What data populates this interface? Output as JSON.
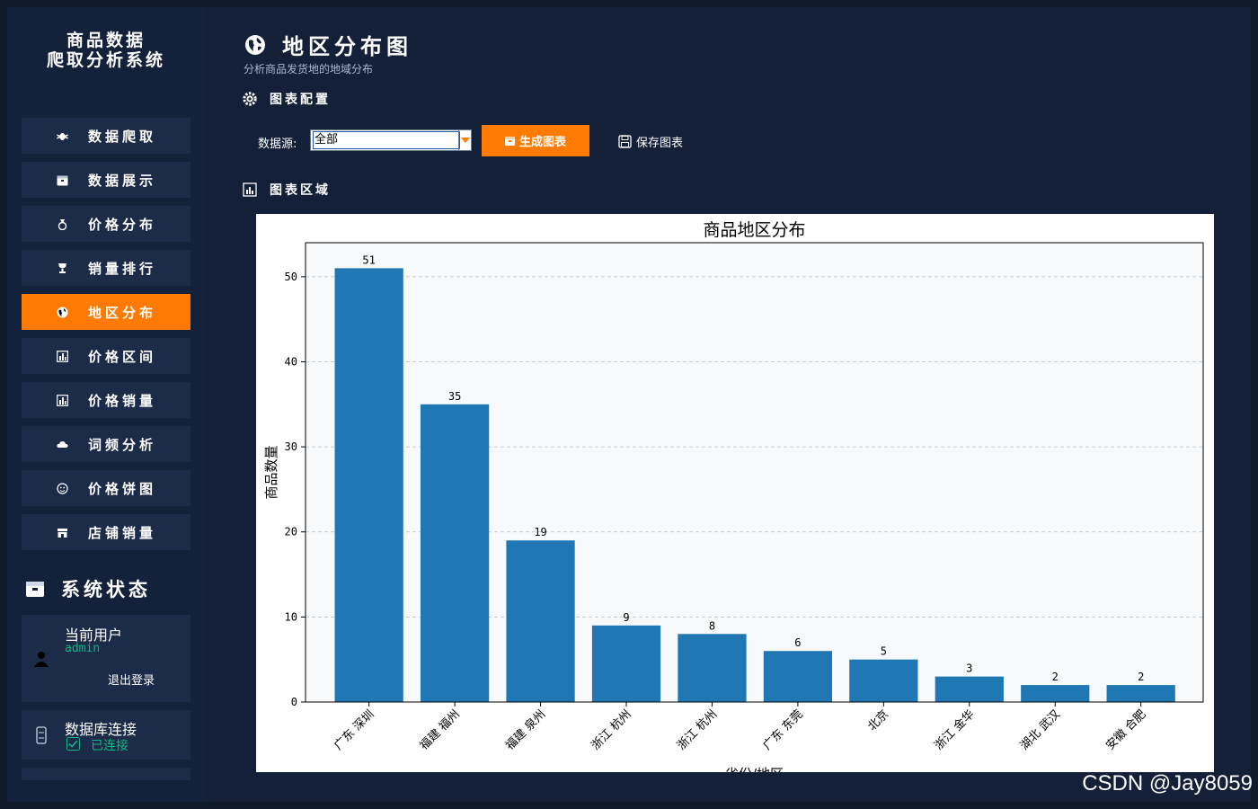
{
  "sidebar": {
    "title_line1": "商品数据",
    "title_line2": "爬取分析系统",
    "nav": [
      {
        "label": "数据爬取",
        "icon": "bug-icon"
      },
      {
        "label": "数据展示",
        "icon": "box-icon"
      },
      {
        "label": "价格分布",
        "icon": "money-bag-icon"
      },
      {
        "label": "销量排行",
        "icon": "trophy-icon"
      },
      {
        "label": "地区分布",
        "icon": "globe-icon"
      },
      {
        "label": "价格区间",
        "icon": "chart-icon"
      },
      {
        "label": "价格销量",
        "icon": "chart-icon"
      },
      {
        "label": "词频分析",
        "icon": "cloud-icon"
      },
      {
        "label": "价格饼图",
        "icon": "pie-icon"
      },
      {
        "label": "店铺销量",
        "icon": "store-icon"
      }
    ],
    "active_index": 4,
    "status_title": "系统状态",
    "user_label": "当前用户",
    "username": "admin",
    "logout_label": "退出登录",
    "db_label": "数据库连接",
    "db_status": "已连接"
  },
  "main": {
    "title": "地区分布图",
    "subtitle": "分析商品发货地的地域分布",
    "config_heading": "图表配置",
    "datasource_label": "数据源:",
    "datasource_value": "全部",
    "generate_label": "生成图表",
    "save_label": "保存图表",
    "chart_heading": "图表区域"
  },
  "credit": "CSDN @Jay8059",
  "chart_data": {
    "type": "bar",
    "title": "商品地区分布",
    "xlabel": "省份/地区",
    "ylabel": "商品数量",
    "categories": [
      "广东 深圳",
      "福建 福州",
      "福建 泉州",
      "浙江 杭州",
      "浙江 杭州",
      "广东 东莞",
      "北京",
      "浙江 金华",
      "湖北 武汉",
      "安徽 合肥"
    ],
    "values": [
      51,
      35,
      19,
      9,
      8,
      6,
      5,
      3,
      2,
      2
    ],
    "ylim": [
      0,
      54
    ],
    "yticks": [
      0,
      10,
      20,
      30,
      40,
      50
    ],
    "grid": "y-dashed",
    "color": "#1f77b4"
  },
  "colors": {
    "accent": "#ff7a00",
    "bar": "#1f77b4",
    "status_ok": "#12b886"
  }
}
